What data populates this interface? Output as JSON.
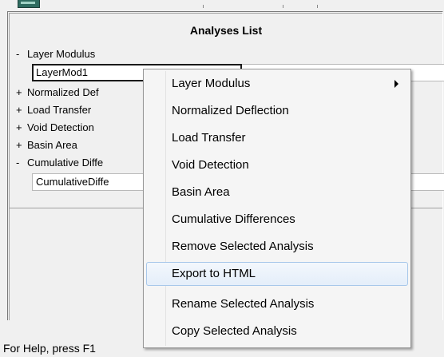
{
  "window": {
    "status_text": "For Help, press F1"
  },
  "panel": {
    "title": "Analyses List",
    "tree": [
      {
        "sign": "-",
        "label": "Layer Modulus"
      },
      {
        "sign": "+",
        "label": "Normalized Def"
      },
      {
        "sign": "+",
        "label": "Load Transfer"
      },
      {
        "sign": "+",
        "label": "Void Detection"
      },
      {
        "sign": "+",
        "label": "Basin Area"
      },
      {
        "sign": "-",
        "label": "Cumulative Diffe"
      }
    ],
    "leaves": [
      {
        "label": "LayerMod1"
      },
      {
        "label": "CumulativeDiffe"
      }
    ]
  },
  "context_menu": {
    "items": [
      {
        "label": "Layer Modulus",
        "has_submenu": true
      },
      {
        "label": "Normalized Deflection"
      },
      {
        "label": "Load Transfer"
      },
      {
        "label": "Void Detection"
      },
      {
        "label": "Basin Area"
      },
      {
        "label": "Cumulative Differences"
      },
      {
        "label": "Remove Selected Analysis"
      },
      {
        "label": "Export to HTML",
        "highlighted": true
      },
      {
        "label": "Rename Selected Analysis"
      },
      {
        "label": "Copy Selected Analysis"
      }
    ]
  },
  "colors": {
    "background": "#f0f0f0",
    "menu_background": "#f5f5f5",
    "highlight_border": "#a8c8ea",
    "selection_border": "#1a1a1a"
  }
}
